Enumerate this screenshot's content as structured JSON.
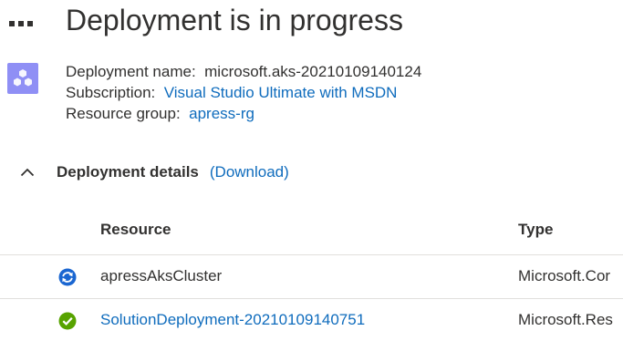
{
  "header": {
    "title": "Deployment is in progress"
  },
  "overview": {
    "deployment_name_label": "Deployment name:",
    "deployment_name_value": "microsoft.aks-20210109140124",
    "subscription_label": "Subscription:",
    "subscription_value": "Visual Studio Ultimate with MSDN",
    "resource_group_label": "Resource group:",
    "resource_group_value": "apress-rg"
  },
  "details": {
    "title": "Deployment details",
    "download_label": "(Download)",
    "expanded": true
  },
  "table": {
    "columns": [
      "Resource",
      "Type"
    ],
    "rows": [
      {
        "resource": "apressAksCluster",
        "type": "Microsoft.Cor",
        "status_icon": "in-progress-icon",
        "resource_is_link": false
      },
      {
        "resource": "SolutionDeployment-20210109140751",
        "type": "Microsoft.Res",
        "status_icon": "success-check-icon",
        "resource_is_link": true
      }
    ]
  },
  "colors": {
    "link": "#0f6cbd",
    "progress": "#1a66d1",
    "success": "#57a300",
    "resource_icon": "#8f8ff5"
  }
}
